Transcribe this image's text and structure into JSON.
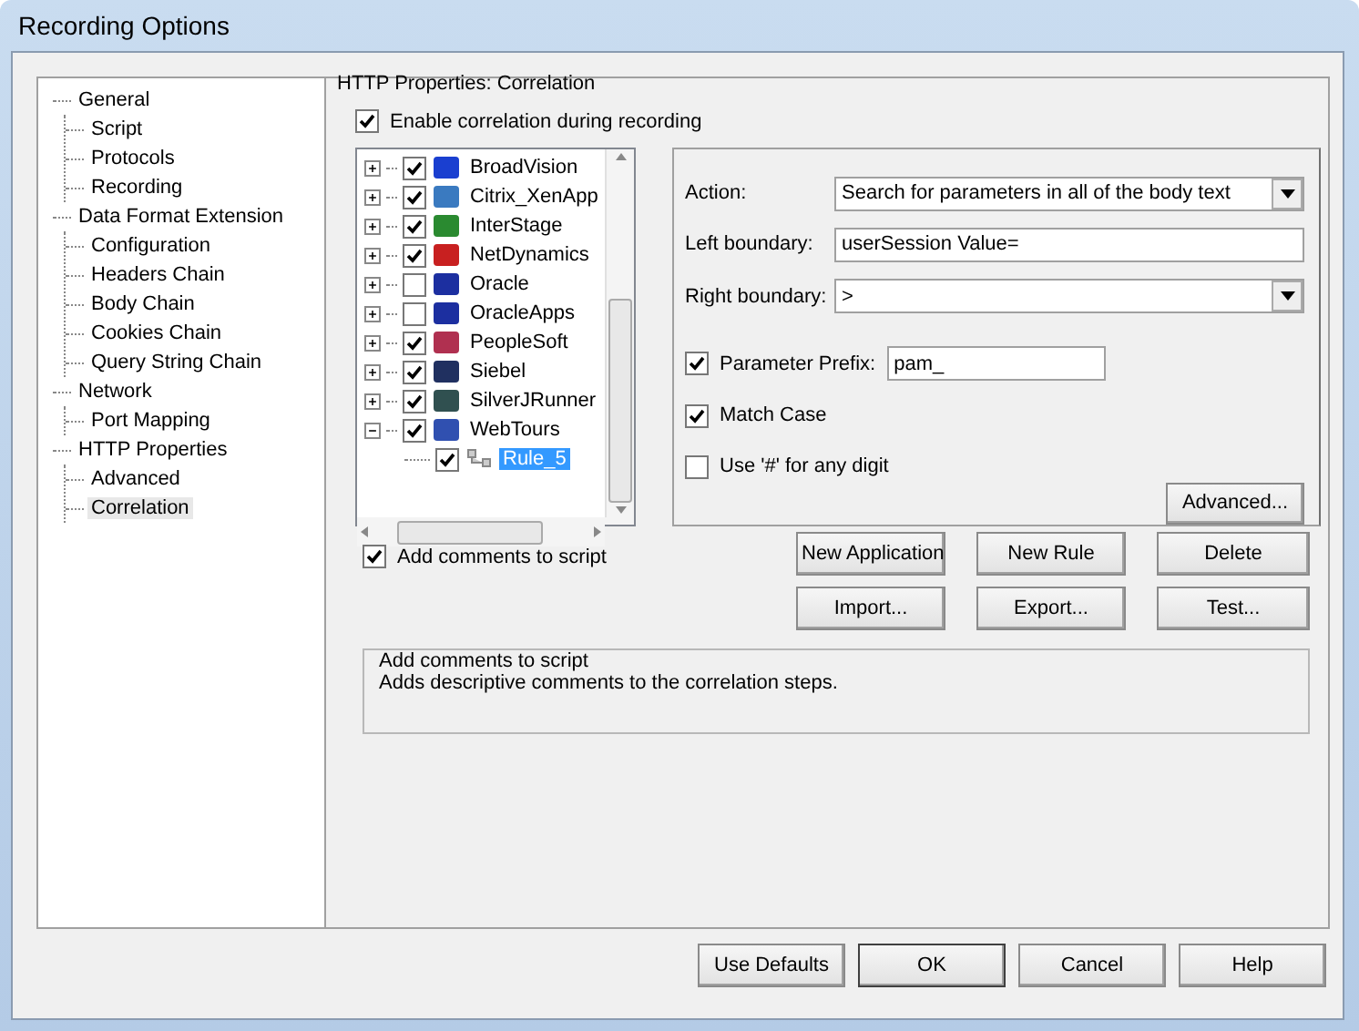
{
  "window": {
    "title": "Recording Options"
  },
  "nav_tree": [
    {
      "label": "General",
      "selected": false,
      "children": [
        {
          "label": "Script",
          "selected": false
        },
        {
          "label": "Protocols",
          "selected": false
        },
        {
          "label": "Recording",
          "selected": false
        }
      ]
    },
    {
      "label": "Data Format Extension",
      "selected": false,
      "children": [
        {
          "label": "Configuration",
          "selected": false
        },
        {
          "label": "Headers Chain",
          "selected": false
        },
        {
          "label": "Body Chain",
          "selected": false
        },
        {
          "label": "Cookies Chain",
          "selected": false
        },
        {
          "label": "Query String Chain",
          "selected": false
        }
      ]
    },
    {
      "label": "Network",
      "selected": false,
      "children": [
        {
          "label": "Port Mapping",
          "selected": false
        }
      ]
    },
    {
      "label": "HTTP Properties",
      "selected": false,
      "children": [
        {
          "label": "Advanced",
          "selected": false
        },
        {
          "label": "Correlation",
          "selected": true
        }
      ]
    }
  ],
  "panel": {
    "title": "HTTP Properties: Correlation",
    "enable_correlation": {
      "label": "Enable correlation during recording",
      "checked": true
    },
    "applications": [
      {
        "name": "BroadVision",
        "checked": true,
        "expanded": false,
        "selected": false,
        "color": "#1a3fd0"
      },
      {
        "name": "Citrix_XenApp",
        "checked": true,
        "expanded": false,
        "selected": false,
        "color": "#3a7ac0"
      },
      {
        "name": "InterStage",
        "checked": true,
        "expanded": false,
        "selected": false,
        "color": "#2a8a30"
      },
      {
        "name": "NetDynamics",
        "checked": true,
        "expanded": false,
        "selected": false,
        "color": "#c82020"
      },
      {
        "name": "Oracle",
        "checked": false,
        "expanded": false,
        "selected": false,
        "color": "#1c2fa0"
      },
      {
        "name": "OracleApps",
        "checked": false,
        "expanded": false,
        "selected": false,
        "color": "#1c2fa0"
      },
      {
        "name": "PeopleSoft",
        "checked": true,
        "expanded": false,
        "selected": false,
        "color": "#b03050"
      },
      {
        "name": "Siebel",
        "checked": true,
        "expanded": false,
        "selected": false,
        "color": "#203060"
      },
      {
        "name": "SilverJRunner",
        "checked": true,
        "expanded": false,
        "selected": false,
        "color": "#305050"
      },
      {
        "name": "WebTours",
        "checked": true,
        "expanded": true,
        "selected": false,
        "color": "#3050b0",
        "children": [
          {
            "name": "Rule_5",
            "checked": true,
            "selected": true
          }
        ]
      }
    ],
    "rule": {
      "action": {
        "label": "Action:",
        "value": "Search for parameters in all of the body text"
      },
      "left_boundary": {
        "label": "Left boundary:",
        "value": "userSession Value="
      },
      "right_boundary": {
        "label": "Right boundary:",
        "value": ">"
      },
      "parameter_prefix": {
        "label": "Parameter Prefix:",
        "checked": true,
        "value": "pam_"
      },
      "match_case": {
        "label": "Match Case",
        "checked": true
      },
      "use_hash": {
        "label": "Use '#' for any digit",
        "checked": false
      },
      "advanced_button": "Advanced..."
    },
    "add_comments": {
      "label": "Add comments to script",
      "checked": true
    },
    "buttons": [
      "New Application",
      "New Rule",
      "Delete",
      "Import...",
      "Export...",
      "Test..."
    ],
    "description": {
      "title": "Add comments to script",
      "text": "Adds descriptive comments to the correlation steps."
    }
  },
  "footer_buttons": [
    {
      "label": "Use Defaults",
      "default": false
    },
    {
      "label": "OK",
      "default": true
    },
    {
      "label": "Cancel",
      "default": false
    },
    {
      "label": "Help",
      "default": false
    }
  ]
}
